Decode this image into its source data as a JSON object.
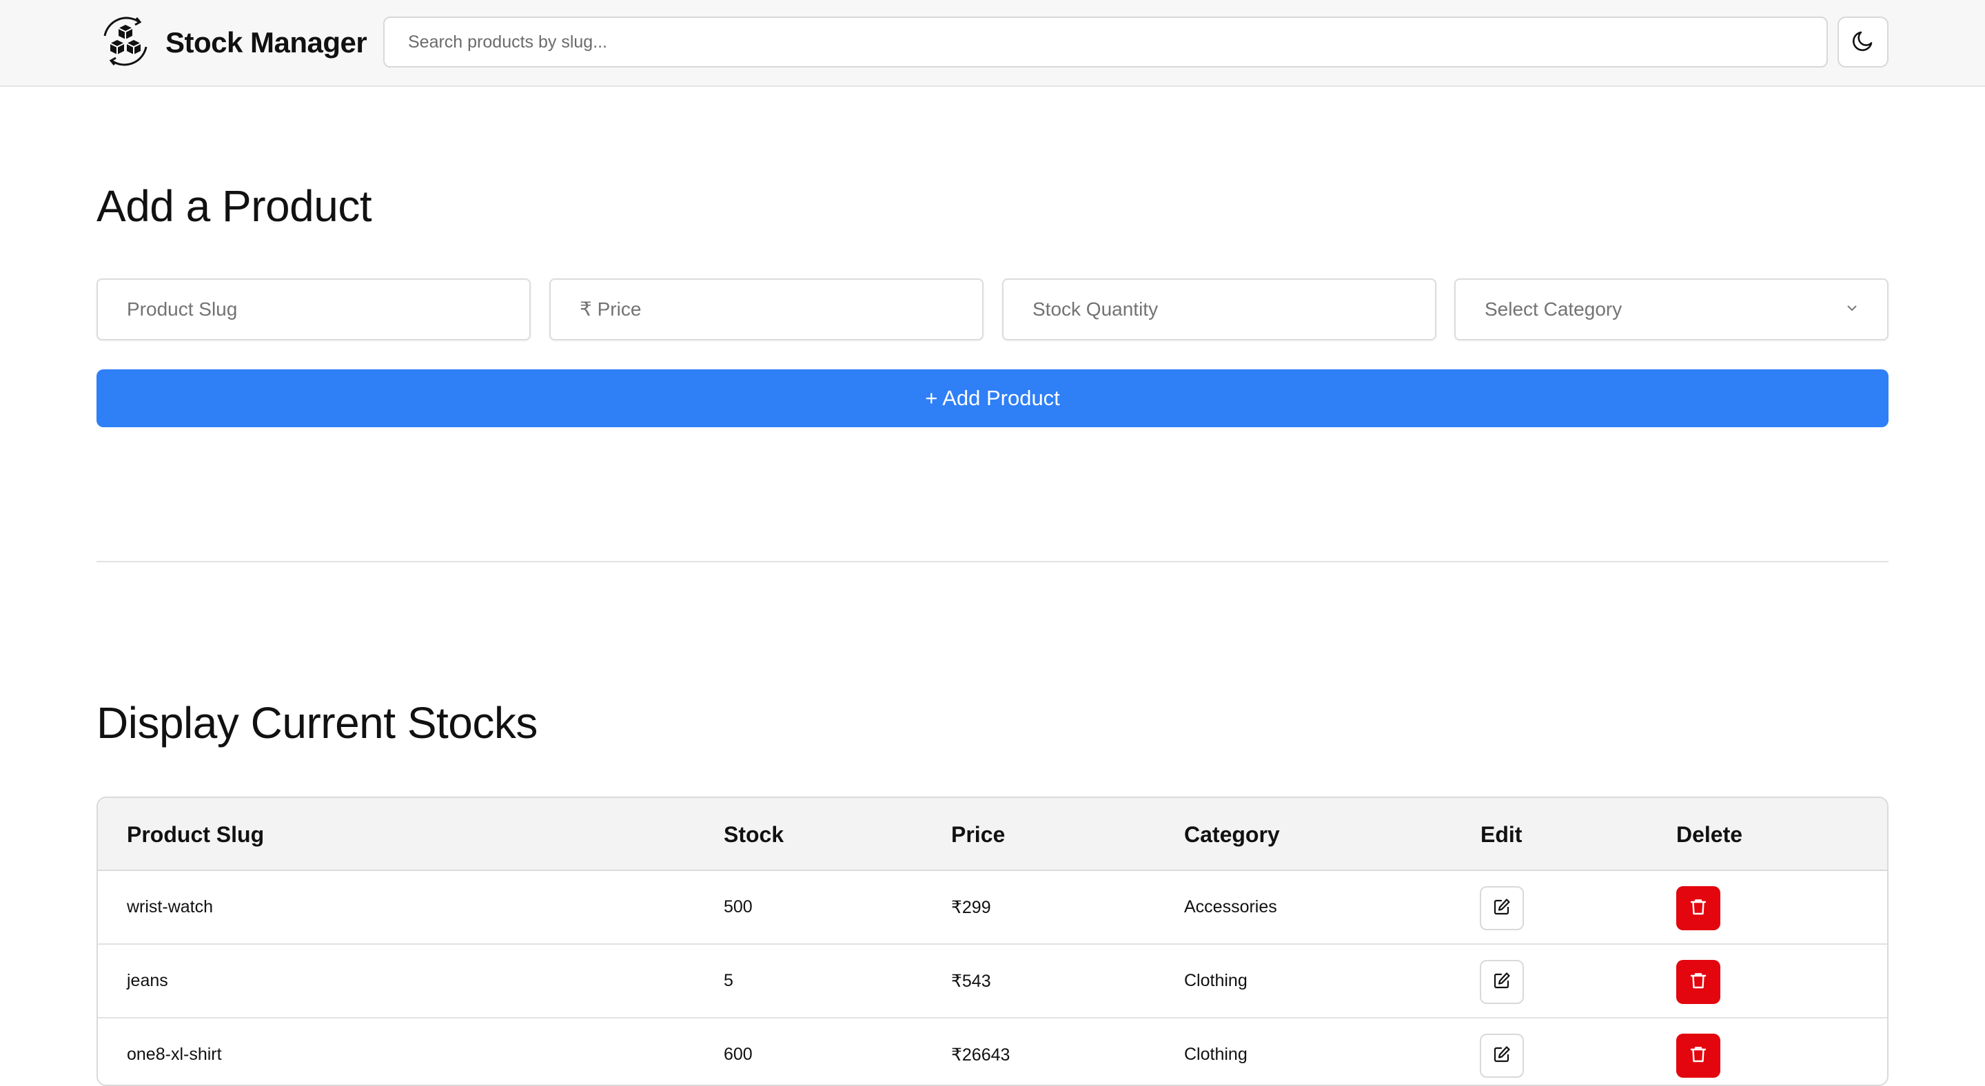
{
  "header": {
    "brand_name": "Stock Manager",
    "search_placeholder": "Search products by slug...",
    "logo_icon": "boxes-cycle-icon",
    "theme_icon": "moon-icon"
  },
  "add_section": {
    "title": "Add a Product",
    "slug_placeholder": "Product Slug",
    "price_placeholder": "₹ Price",
    "quantity_placeholder": "Stock Quantity",
    "category_selected": "Select Category",
    "add_button_label": "+ Add Product"
  },
  "stocks_section": {
    "title": "Display Current Stocks",
    "columns": [
      "Product Slug",
      "Stock",
      "Price",
      "Category",
      "Edit",
      "Delete"
    ],
    "rows": [
      {
        "slug": "wrist-watch",
        "stock": "500",
        "price": "₹299",
        "category": "Accessories"
      },
      {
        "slug": "jeans",
        "stock": "5",
        "price": "₹543",
        "category": "Clothing"
      },
      {
        "slug": "one8-xl-shirt",
        "stock": "600",
        "price": "₹26643",
        "category": "Clothing"
      }
    ]
  },
  "colors": {
    "primary": "#2f7ff7",
    "danger": "#e3060f",
    "header_bg": "#f7f7f7"
  }
}
